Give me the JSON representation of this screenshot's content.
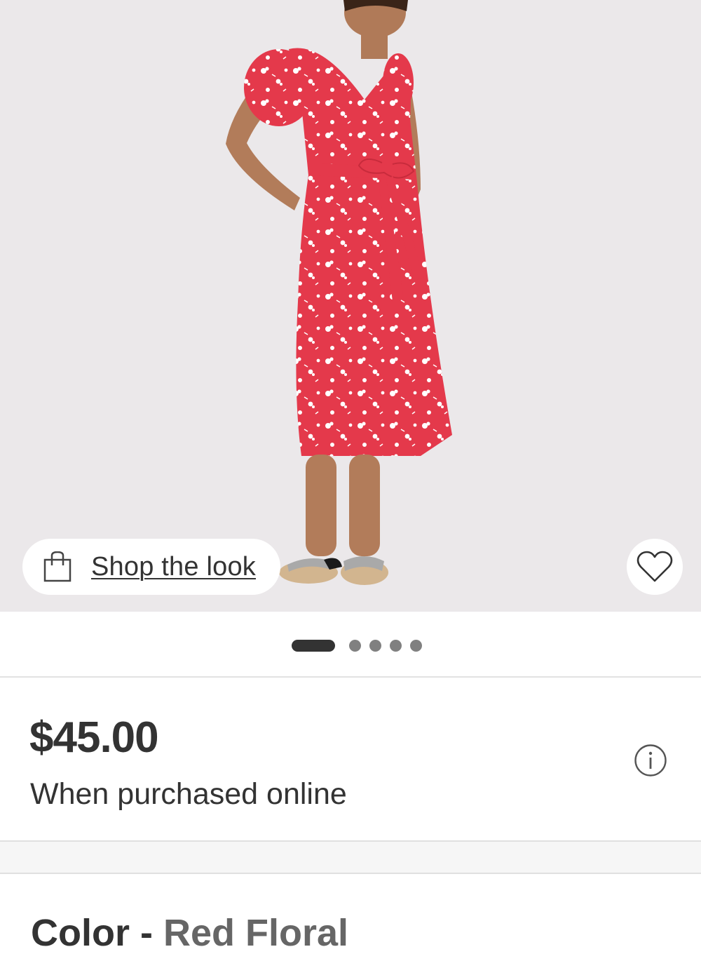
{
  "hero": {
    "image_description": "Model wearing red floral wrap midi dress",
    "shop_the_look_label": "Shop the look"
  },
  "carousel": {
    "count": 5,
    "active_index": 0
  },
  "pricing": {
    "price": "$45.00",
    "note": "When purchased online"
  },
  "color": {
    "label": "Color",
    "separator": " - ",
    "value": "Red Floral"
  },
  "colors": {
    "dress": "#e4394b",
    "background": "#ebe8ea",
    "text": "#333333"
  },
  "icons": {
    "shop_icon": "shopping-bag-icon",
    "favorite_icon": "heart-icon",
    "info_icon": "info-icon"
  }
}
